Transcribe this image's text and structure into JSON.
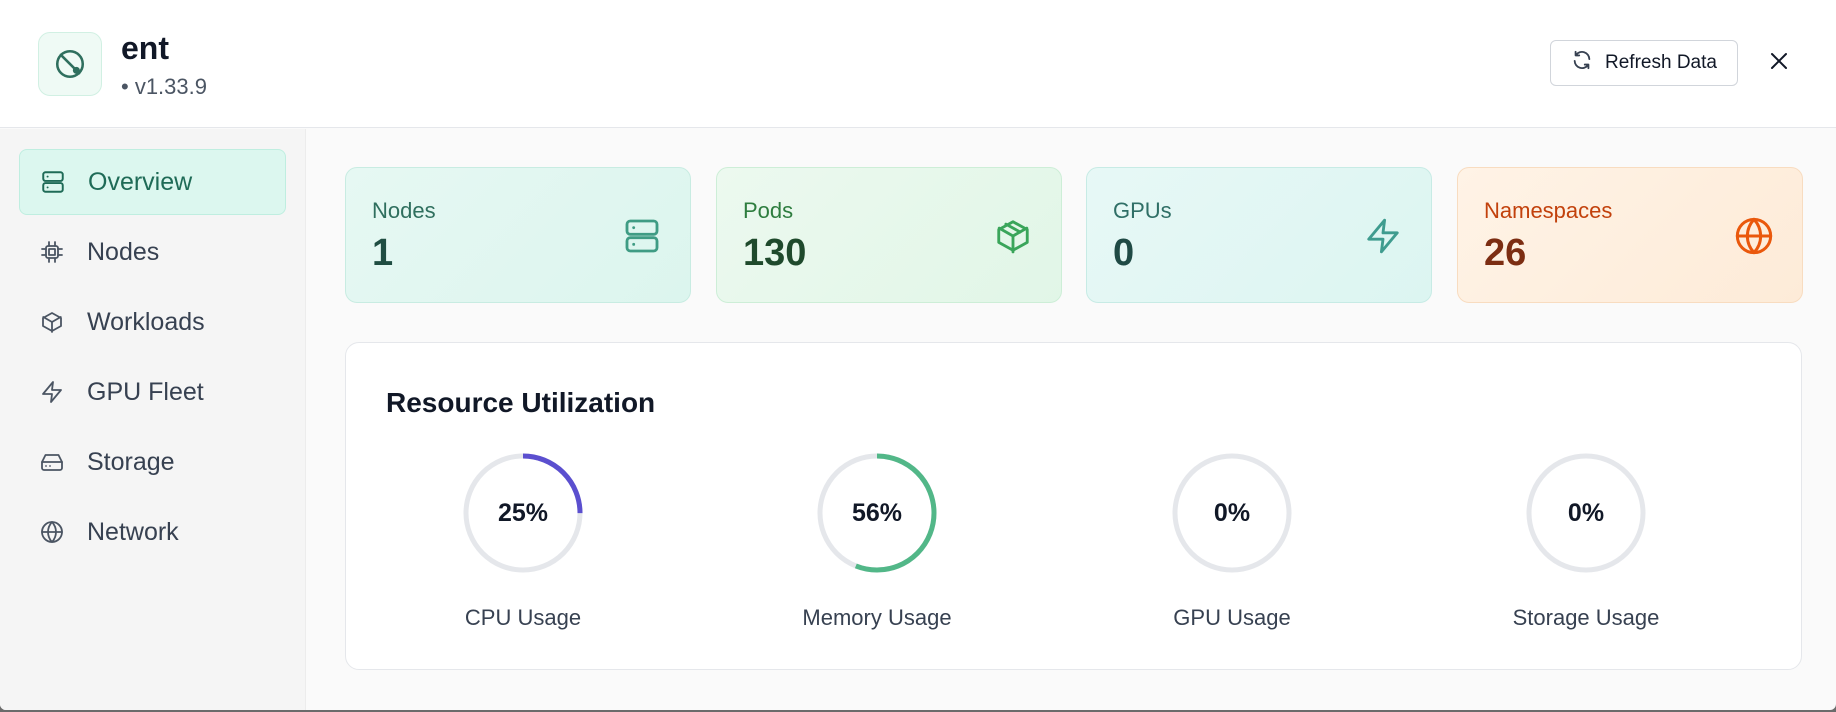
{
  "app": {
    "title": "ent",
    "version": "• v1.33.9",
    "refresh_label": "Refresh Data"
  },
  "sidebar": {
    "items": [
      {
        "label": "Overview",
        "icon": "server-icon",
        "active": true
      },
      {
        "label": "Nodes",
        "icon": "cpu-icon",
        "active": false
      },
      {
        "label": "Workloads",
        "icon": "box-icon",
        "active": false
      },
      {
        "label": "GPU Fleet",
        "icon": "lightning-icon",
        "active": false
      },
      {
        "label": "Storage",
        "icon": "hard-drive-icon",
        "active": false
      },
      {
        "label": "Network",
        "icon": "globe-icon",
        "active": false
      }
    ]
  },
  "stats": {
    "nodes": {
      "label": "Nodes",
      "value": "1",
      "icon": "server-icon",
      "color": "#3f9c84"
    },
    "pods": {
      "label": "Pods",
      "value": "130",
      "icon": "box-icon",
      "color": "#3aa55a"
    },
    "gpus": {
      "label": "GPUs",
      "value": "0",
      "icon": "lightning-icon",
      "color": "#3f9c8f"
    },
    "namespaces": {
      "label": "Namespaces",
      "value": "26",
      "icon": "globe-icon",
      "color": "#ea580c"
    }
  },
  "resource": {
    "title": "Resource Utilization",
    "gauges": [
      {
        "label": "CPU Usage",
        "value_text": "25%",
        "percent": 25,
        "color": "#5b4fcf"
      },
      {
        "label": "Memory Usage",
        "value_text": "56%",
        "percent": 56,
        "color": "#52b788"
      },
      {
        "label": "GPU Usage",
        "value_text": "0%",
        "percent": 0,
        "color": "#9ca3af"
      },
      {
        "label": "Storage Usage",
        "value_text": "0%",
        "percent": 0,
        "color": "#9ca3af"
      }
    ]
  }
}
